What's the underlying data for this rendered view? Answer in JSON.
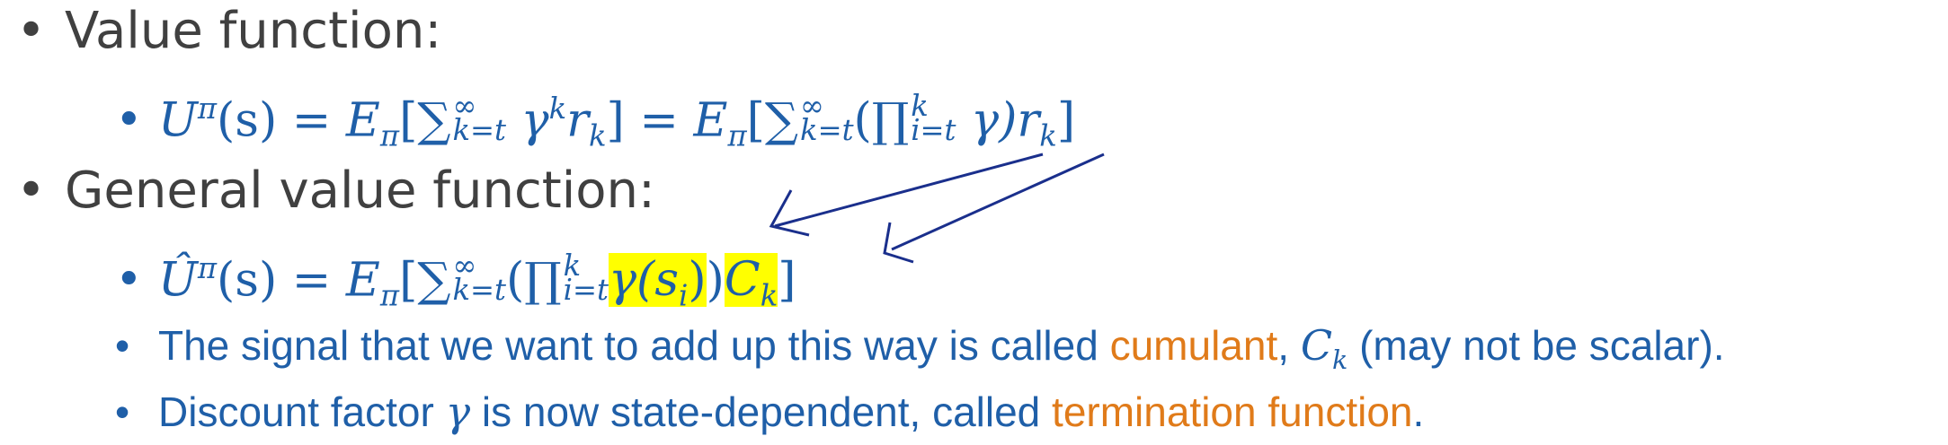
{
  "bullets": {
    "b1_text": "Value function:",
    "b3_text": "General value function:",
    "b5_pre": "The signal that we want to add up this way is called ",
    "b5_term": "cumulant",
    "b5_mid": ", ",
    "b5_math": "C",
    "b5_sub": "k",
    "b5_post": " (may not be scalar).",
    "b6_pre": "Discount factor ",
    "b6_math": "γ",
    "b6_mid": " is now state-dependent, called ",
    "b6_term": "termination function",
    "b6_post": "."
  },
  "equation1": {
    "lhs": "U",
    "lhs_sup": "π",
    "lhs_arg": "(s) = ",
    "E": "E",
    "E_sub": "π",
    "bracket_open": "[∑",
    "sum_sup": "∞",
    "sum_sub": "k=t",
    "gamma": " γ",
    "gamma_sup": "k",
    "r": "r",
    "r_sub": "k",
    "mid": "] = ",
    "E2": "E",
    "E2_sub": "π",
    "bracket2_open": "[∑",
    "prod_open": "(∏",
    "prod_sup": "k",
    "prod_sub": "i=t",
    "gamma2": " γ)",
    "r2": "r",
    "r2_sub": "k",
    "bracket2_close": "]"
  },
  "equation2": {
    "lhs": "Û",
    "lhs_sup": "π",
    "lhs_arg": "(s) = ",
    "E": "E",
    "E_sub": "π",
    "bracket_open": "[∑",
    "sum_sup": "∞",
    "sum_sub": "k=t",
    "prod_open": "(∏",
    "prod_sup": "k",
    "prod_sub": "i=t",
    "gamma_s": "γ(s",
    "gamma_s_sub": "i",
    "gamma_s_close": ")",
    "prod_close": ")",
    "C": "C",
    "C_sub": "k",
    "bracket_close": "]"
  },
  "colors": {
    "heading": "#404040",
    "math_blue": "#1f5fa8",
    "orange": "#e07b1a",
    "highlight": "#ffff00",
    "arrow": "#1a2f8c"
  }
}
